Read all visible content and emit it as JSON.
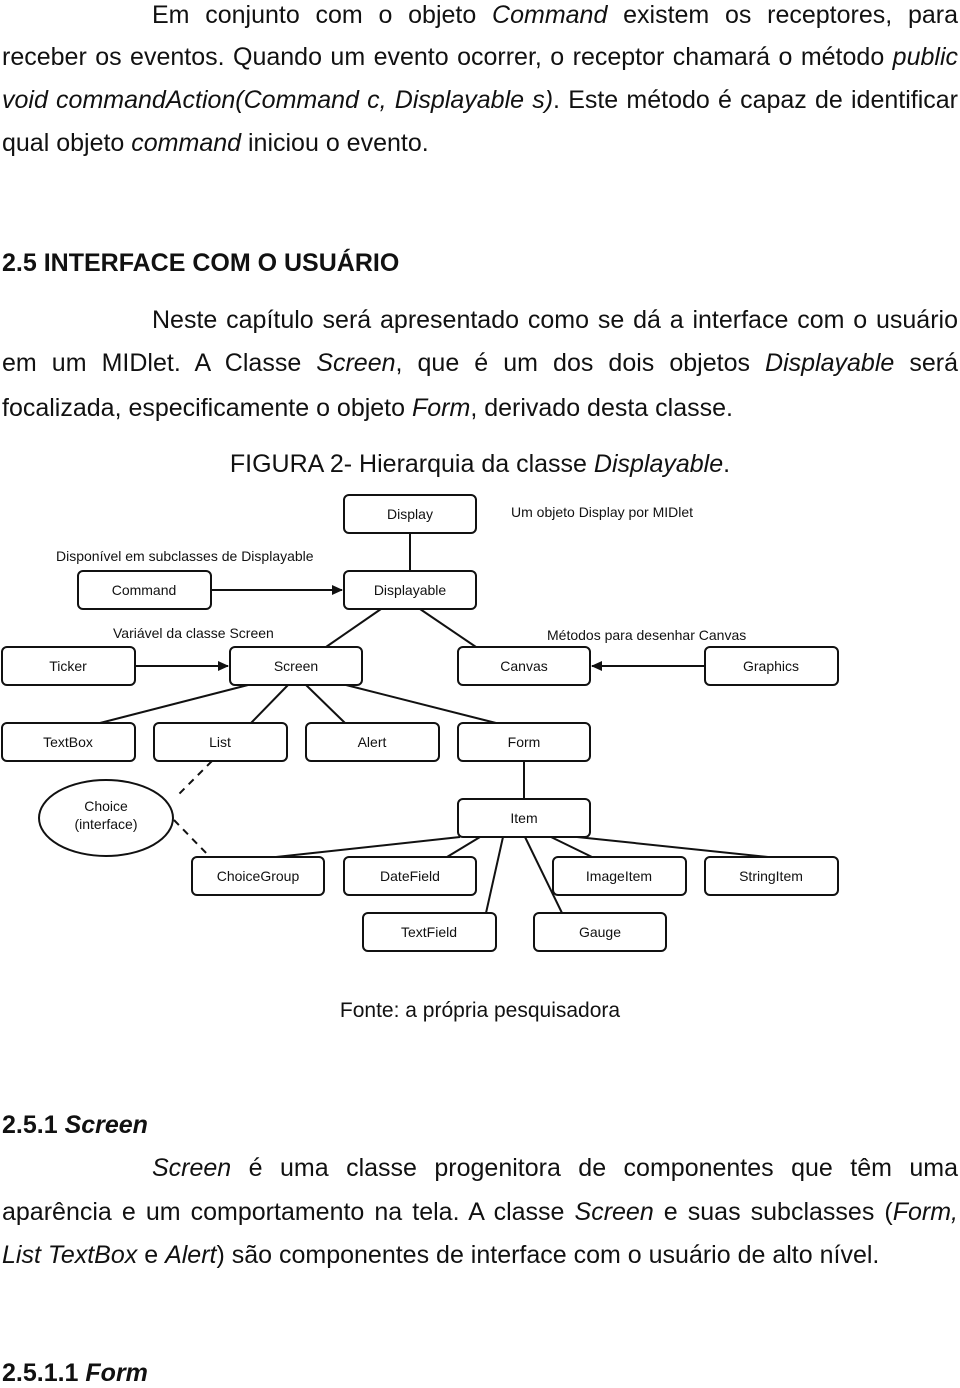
{
  "paragraph1": {
    "l1a": "Em conjunto com o objeto ",
    "l1b": "Command",
    "l1c": " existem os receptores, para",
    "l2a": "receber os eventos. Quando um evento ocorrer, o receptor chamará o método ",
    "l2b": "public",
    "l3a": "void commandAction(Command c, Displayable s)",
    "l3b": ". Este método é capaz de identificar",
    "l4a": "qual objeto ",
    "l4b": "command",
    "l4c": " iniciou o evento."
  },
  "section_2_5": {
    "heading": "2.5 INTERFACE COM O USUÁRIO",
    "l1": "Neste capítulo será apresentado como se dá a interface com o usuário",
    "l2a": "em um MIDlet. A Classe ",
    "l2b": "Screen",
    "l2c": ", que é um dos dois objetos ",
    "l2d": "Displayable",
    "l2e": " será",
    "l3a": "focalizada, especificamente o objeto ",
    "l3b": "Form",
    "l3c": ", derivado desta classe."
  },
  "figure": {
    "caption_a": "FIGURA 2- Hierarquia da classe ",
    "caption_b": "Displayable",
    "caption_c": ".",
    "source": "Fonte: a própria pesquisadora",
    "annotations": {
      "display": "Um objeto Display por MIDlet",
      "command": "Disponível em subclasses de Displayable",
      "ticker": "Variável da classe Screen",
      "graphics": "Métodos para desenhar Canvas"
    },
    "nodes": {
      "display": "Display",
      "command": "Command",
      "displayable": "Displayable",
      "ticker": "Ticker",
      "screen": "Screen",
      "canvas": "Canvas",
      "graphics": "Graphics",
      "textbox": "TextBox",
      "list": "List",
      "alert": "Alert",
      "form": "Form",
      "choice_1": "Choice",
      "choice_2": "(interface)",
      "item": "Item",
      "choicegroup": "ChoiceGroup",
      "datefield": "DateField",
      "imageitem": "ImageItem",
      "stringitem": "StringItem",
      "textfield": "TextField",
      "gauge": "Gauge"
    }
  },
  "section_2_5_1": {
    "heading_num": "2.5.1 ",
    "heading_title": "Screen",
    "l1a": "Screen",
    "l1b": " é uma classe progenitora de componentes que têm uma",
    "l2a": "aparência e um comportamento na tela. A classe ",
    "l2b": "Screen",
    "l2c": " e suas subclasses (",
    "l2d": "Form,",
    "l3a": "List TextBox",
    "l3b": " e ",
    "l3c": "Alert",
    "l3d": ") são componentes de interface com o usuário de alto nível."
  },
  "section_2_5_1_1": {
    "heading_num": "2.5.1.1 ",
    "heading_title": "Form"
  }
}
